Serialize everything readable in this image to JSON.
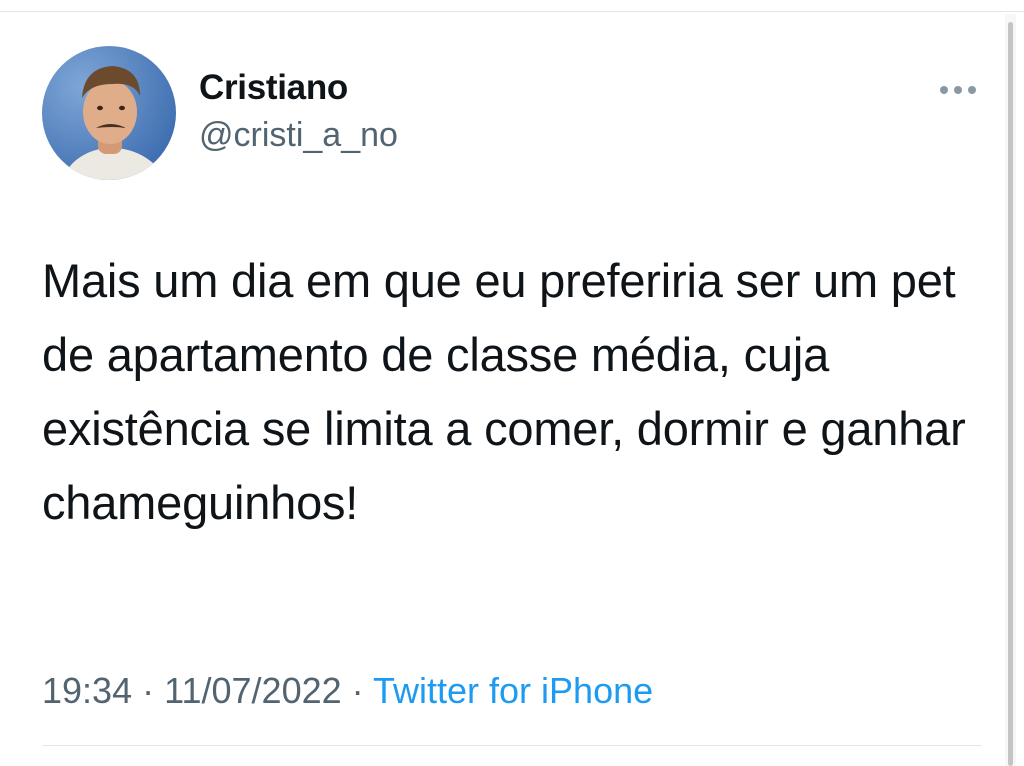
{
  "tweet": {
    "author": {
      "display_name": "Cristiano",
      "handle": "@cristi_a_no",
      "avatar_icon": "profile-photo"
    },
    "more_icon": "more-horizontal-icon",
    "text": "Mais um dia em que eu preferiria ser um pet de apartamento de classe média, cuja existência se limita a comer, dormir e ganhar chameguinhos!",
    "time": "19:34",
    "separator": "·",
    "date": "11/07/2022",
    "source": "Twitter for iPhone"
  },
  "colors": {
    "text_primary": "#0f1419",
    "text_secondary": "#536471",
    "link": "#1d9bf0",
    "divider": "#e6e6e6"
  }
}
